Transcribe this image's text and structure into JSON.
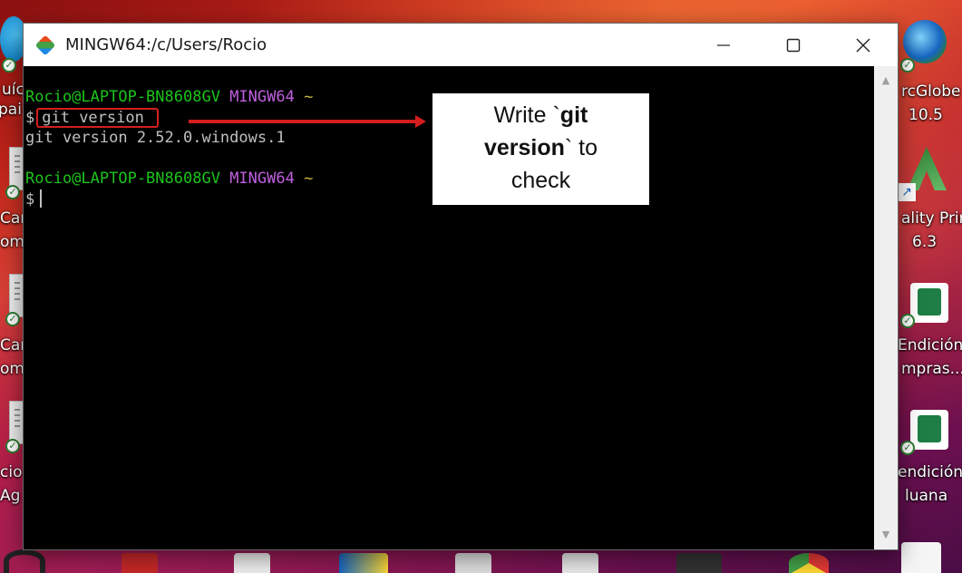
{
  "window": {
    "title": "MINGW64:/c/Users/Rocio",
    "minimize_icon": "minimize-icon",
    "maximize_icon": "maximize-icon",
    "close_icon": "close-icon"
  },
  "terminal": {
    "lines": [
      {
        "user": "Rocio@LAPTOP-BN8608GV",
        "env": "MINGW64",
        "path": "~"
      },
      {
        "prompt": "$",
        "command": "git version"
      },
      {
        "output": "git version 2.52.0.windows.1"
      },
      {
        "user": "Rocio@LAPTOP-BN8608GV",
        "env": "MINGW64",
        "path": "~"
      },
      {
        "prompt": "$"
      }
    ]
  },
  "annotation": {
    "prefix": "Write `",
    "bold1": "git",
    "bold2": "version",
    "suffix": "` to",
    "last": "check",
    "color": "#d41e1e"
  },
  "desktop": {
    "left_labels": [
      "uíc",
      "pai",
      "Car",
      "om",
      "Car",
      "om",
      "cio",
      "Ag"
    ],
    "right_icons": [
      {
        "line1": "rcGlobe",
        "line2": "10.5"
      },
      {
        "line1": "ality Prir",
        "line2": "6.3"
      },
      {
        "line1": "Endición",
        "line2": "mpras..."
      },
      {
        "line1": "endición",
        "line2": "luana"
      }
    ]
  }
}
